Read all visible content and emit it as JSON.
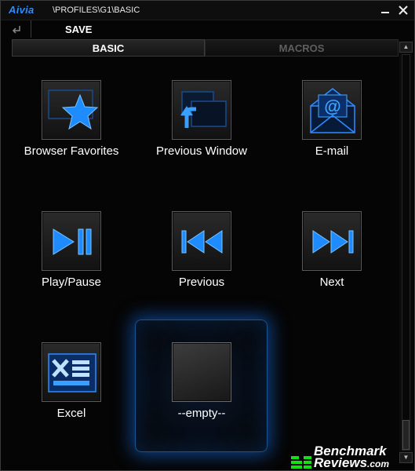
{
  "window": {
    "logo": "Aivia",
    "path": "\\PROFILES\\G1\\BASIC",
    "minimize_icon": "minimize-icon",
    "close_icon": "close-icon"
  },
  "toolbar": {
    "back_icon": "back-arrow-icon",
    "save_label": "SAVE"
  },
  "tabs": [
    {
      "label": "BASIC",
      "active": true
    },
    {
      "label": "MACROS",
      "active": false
    }
  ],
  "slots": [
    {
      "label": "Browser Favorites",
      "icon": "star-icon"
    },
    {
      "label": "Previous Window",
      "icon": "previous-window-icon"
    },
    {
      "label": "E-mail",
      "icon": "email-icon"
    },
    {
      "label": "Play/Pause",
      "icon": "play-pause-icon"
    },
    {
      "label": "Previous",
      "icon": "previous-track-icon"
    },
    {
      "label": "Next",
      "icon": "next-track-icon"
    },
    {
      "label": "Excel",
      "icon": "excel-icon"
    },
    {
      "label": "--empty--",
      "icon": "empty-slot",
      "selected": true
    }
  ],
  "watermark": {
    "line1": "Benchmark",
    "line2": "Reviews",
    "suffix": ".com"
  },
  "colors": {
    "accent": "#1e8cff",
    "glow": "#1a6fe0",
    "watermark_green": "#12e012"
  }
}
